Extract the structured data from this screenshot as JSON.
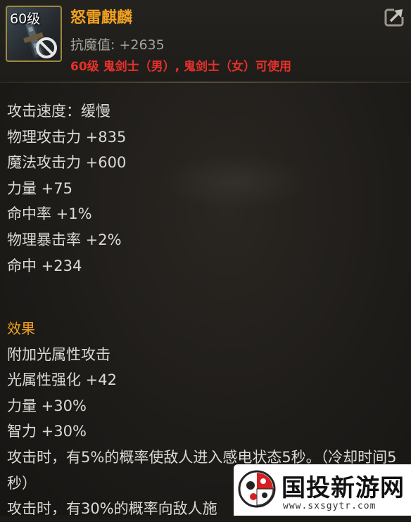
{
  "item": {
    "level_badge": "60级",
    "name": "怒雷麒麟",
    "resist_label": "抗魔值:",
    "resist_value": "+2635",
    "requirement": "60级 鬼剑士（男）, 鬼剑士（女）可使用",
    "icon": "dark-blade-weapon-icon",
    "restricted_icon": "no-entry-icon",
    "share_icon": "share-arrow-icon"
  },
  "stats": [
    "攻击速度：缓慢",
    "物理攻击力 +835",
    "魔法攻击力 +600",
    "力量 +75",
    "命中率 +1%",
    "物理暴击率 +2%",
    "命中 +234"
  ],
  "effects": {
    "title": "效果",
    "lines": [
      "附加光属性攻击",
      "光属性强化 +42",
      "力量 +30%",
      "智力 +30%",
      "攻击时，有5%的概率使敌人进入感电状态5秒。（冷却时间5秒）",
      "攻击时，有30%的概率向敌人施"
    ]
  },
  "watermark": {
    "name": "国投新游网",
    "url": "www.sxsgytr.com",
    "logo_icon": "ladybug-logo-icon"
  },
  "colors": {
    "name": "#f0a020",
    "requirement": "#e8302a",
    "stat_text": "#dcdad5",
    "secondary_text": "#a7a39c",
    "background": "#1c1a17",
    "icon_border": "#a08a3a"
  }
}
